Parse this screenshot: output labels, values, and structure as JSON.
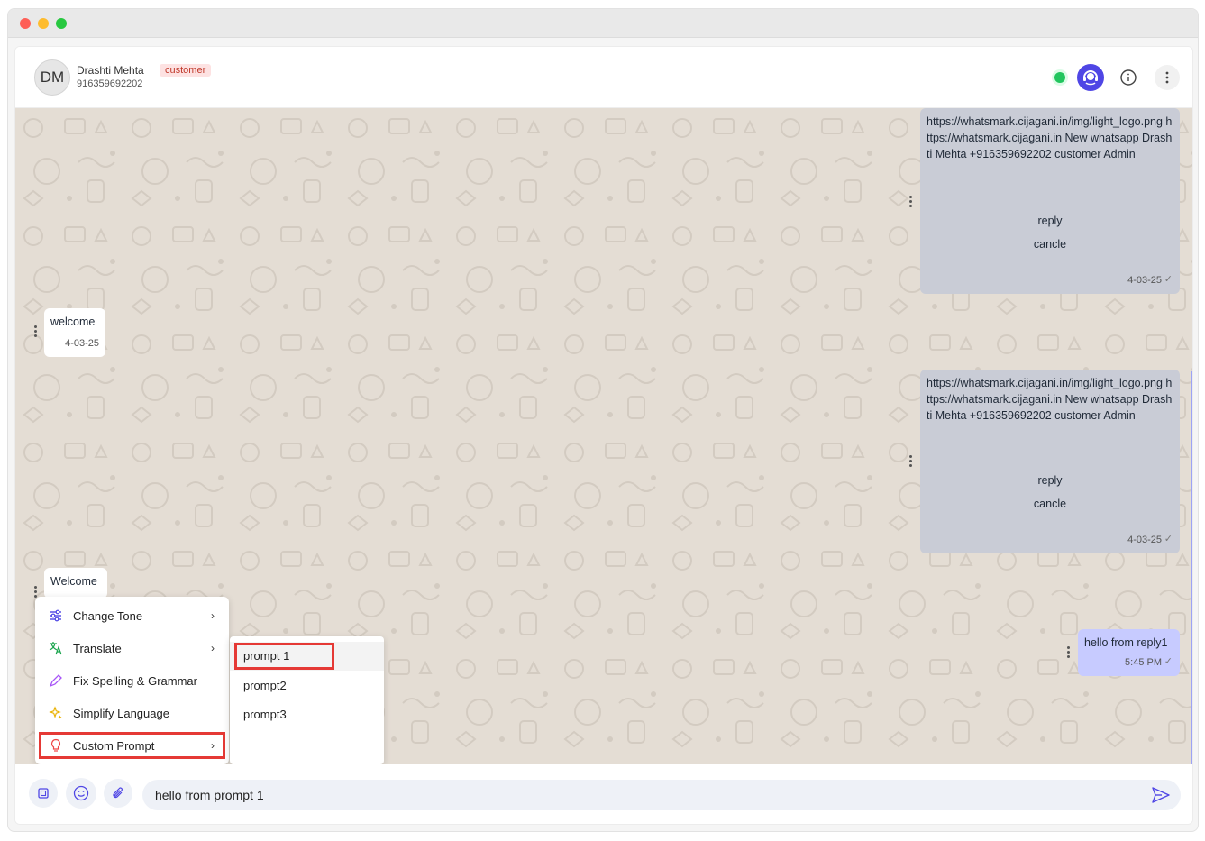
{
  "header": {
    "avatar_initials": "DM",
    "contact_name": "Drashti Mehta",
    "contact_phone": "916359692202",
    "badge": "customer"
  },
  "messages": [
    {
      "direction": "outgoing",
      "text": "https://whatsmark.cijagani.in/img/light_logo.png https://whatsmark.cijagani.in New whatsapp Drashti Mehta +916359692202 customer Admin",
      "buttons": [
        "reply",
        "cancle"
      ],
      "time": "4-03-25"
    },
    {
      "direction": "incoming",
      "text": "welcome",
      "time": "4-03-25"
    },
    {
      "direction": "outgoing",
      "text": "https://whatsmark.cijagani.in/img/light_logo.png https://whatsmark.cijagani.in New whatsapp Drashti Mehta +916359692202 customer Admin",
      "buttons": [
        "reply",
        "cancle"
      ],
      "time": "4-03-25"
    },
    {
      "direction": "incoming",
      "text": "Welcome"
    },
    {
      "direction": "outgoing",
      "text": "hello from reply1",
      "time": "5:45 PM"
    }
  ],
  "ai_menu": {
    "items": [
      {
        "label": "Change Tone",
        "icon": "sliders-icon",
        "has_submenu": true
      },
      {
        "label": "Translate",
        "icon": "translate-icon",
        "has_submenu": true
      },
      {
        "label": "Fix Spelling & Grammar",
        "icon": "pencil-icon",
        "has_submenu": false
      },
      {
        "label": "Simplify Language",
        "icon": "sparkles-icon",
        "has_submenu": false
      },
      {
        "label": "Custom Prompt",
        "icon": "lightbulb-icon",
        "has_submenu": true,
        "highlighted": true
      }
    ],
    "submenu": [
      {
        "label": "prompt 1",
        "active": true
      },
      {
        "label": "prompt2"
      },
      {
        "label": "prompt3"
      }
    ]
  },
  "composer": {
    "value": "hello from prompt 1"
  },
  "colors": {
    "accent": "#4f46e5",
    "online": "#22c55e",
    "outgoing_bubble": "#c9ccd6",
    "outgoing_bubble_recent": "#c7cbff",
    "highlight_box": "#e53935",
    "chat_background": "#e4ddd4"
  }
}
